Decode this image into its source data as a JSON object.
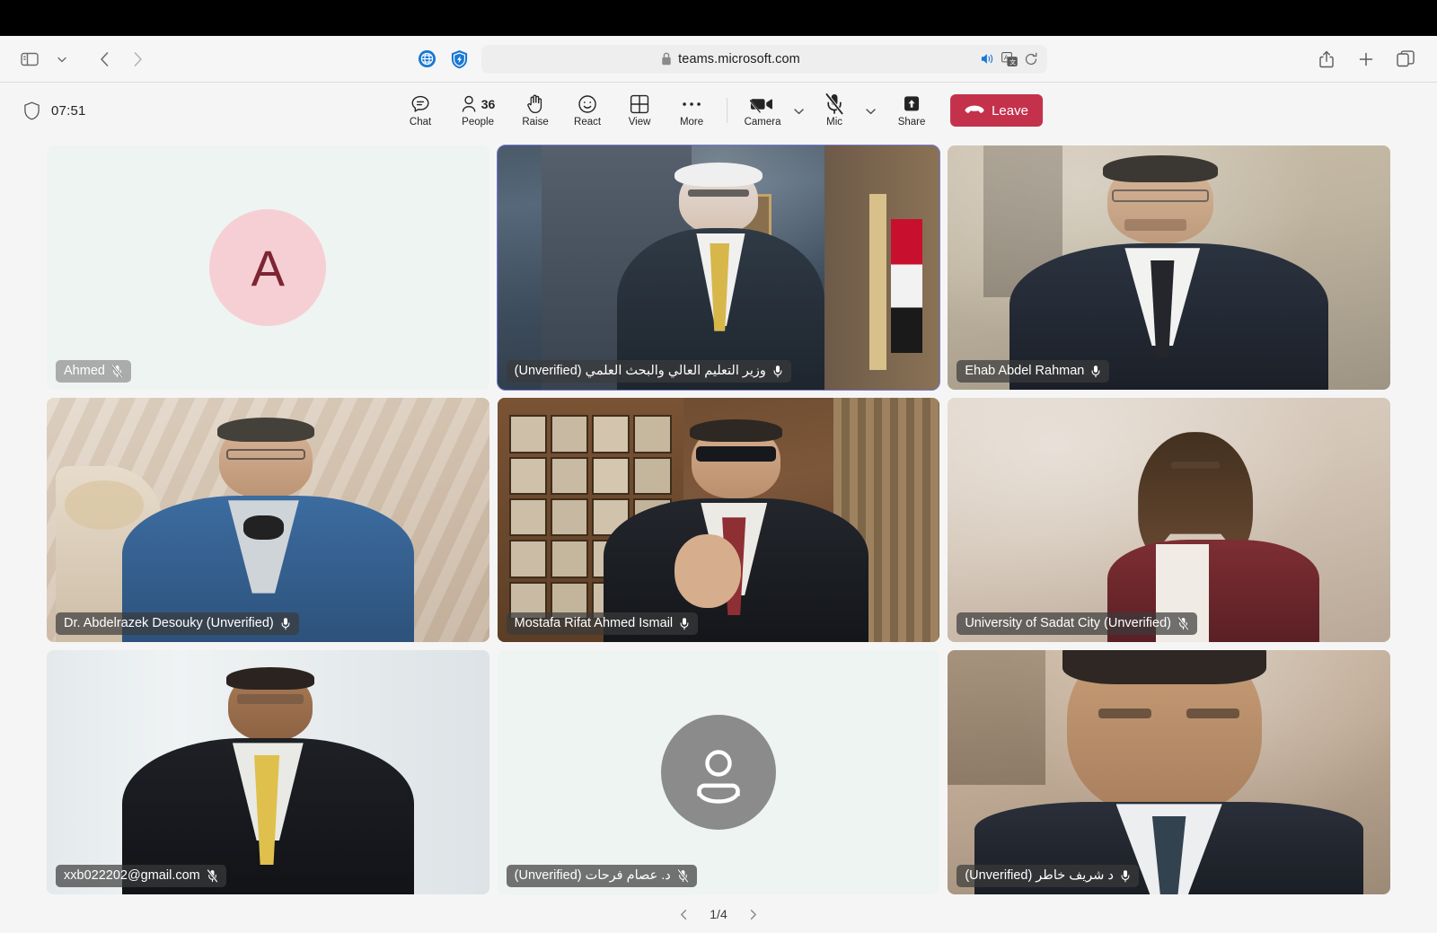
{
  "browser": {
    "url": "teams.microsoft.com",
    "lock_icon": "lock-icon",
    "nav": {
      "sidebar_icon": "sidebar-toggle-icon",
      "sidebar_chevron_icon": "chevron-down-icon",
      "back_icon": "back-arrow-icon",
      "forward_icon": "forward-arrow-icon"
    },
    "extensions": {
      "globe_icon": "globe-icon",
      "shield_icon": "shield-extension-icon"
    },
    "urlbar_right": {
      "speaker_icon": "speaker-playing-icon",
      "translate_icon": "translate-icon",
      "reload_icon": "reload-icon"
    },
    "right_buttons": {
      "share_icon": "share-icon",
      "new_tab_icon": "plus-new-tab-icon",
      "tab_overview_icon": "tab-overview-icon"
    }
  },
  "teams": {
    "status": {
      "shield_icon": "shield-icon",
      "elapsed_time": "07:51"
    },
    "toolbar": [
      {
        "id": "chat",
        "label": "Chat",
        "icon": "chat-bubble-icon",
        "badge": null
      },
      {
        "id": "people",
        "label": "People",
        "icon": "people-icon",
        "badge": "36"
      },
      {
        "id": "raise",
        "label": "Raise",
        "icon": "raised-hand-icon",
        "badge": null
      },
      {
        "id": "react",
        "label": "React",
        "icon": "smiley-face-icon",
        "badge": null
      },
      {
        "id": "view",
        "label": "View",
        "icon": "grid-view-icon",
        "badge": null
      },
      {
        "id": "more",
        "label": "More",
        "icon": "ellipsis-icon",
        "badge": null
      }
    ],
    "devices": [
      {
        "id": "camera",
        "label": "Camera",
        "icon": "camera-off-icon",
        "state": "off",
        "has_chevron": true
      },
      {
        "id": "mic",
        "label": "Mic",
        "icon": "mic-off-icon",
        "state": "off",
        "has_chevron": true
      },
      {
        "id": "share",
        "label": "Share",
        "icon": "share-screen-icon",
        "state": "idle",
        "has_chevron": false
      }
    ],
    "leave": {
      "label": "Leave",
      "icon": "hangup-phone-icon",
      "color": "#c4314b"
    },
    "pagination": {
      "page_label": "1/4",
      "prev_icon": "chevron-left-icon",
      "next_icon": "chevron-right-icon"
    },
    "participants": [
      {
        "id": "ahmed",
        "name": "Ahmed",
        "muted": true,
        "active_speaker": false,
        "tile_type": "avatar-letter",
        "avatar_letter": "A",
        "avatar_bg": "#f6cfd4",
        "avatar_fg": "#7d2533",
        "label_style": "light"
      },
      {
        "id": "minister",
        "name": "وزير التعليم العالي والبحث العلمي (Unverified)",
        "muted": false,
        "active_speaker": true,
        "tile_type": "video",
        "label_style": "dark"
      },
      {
        "id": "ehab",
        "name": "Ehab Abdel Rahman",
        "muted": false,
        "active_speaker": false,
        "tile_type": "video",
        "label_style": "dark"
      },
      {
        "id": "abdelrazek",
        "name": "Dr. Abdelrazek Desouky (Unverified)",
        "muted": false,
        "active_speaker": false,
        "tile_type": "video",
        "label_style": "dark"
      },
      {
        "id": "mostafa",
        "name": "Mostafa Rifat Ahmed Ismail",
        "muted": false,
        "active_speaker": false,
        "tile_type": "video",
        "label_style": "dark"
      },
      {
        "id": "sadat",
        "name": "University of Sadat City (Unverified)",
        "muted": true,
        "active_speaker": false,
        "tile_type": "video",
        "label_style": "dark"
      },
      {
        "id": "xxb",
        "name": "xxb022202@gmail.com",
        "muted": true,
        "active_speaker": false,
        "tile_type": "video",
        "label_style": "dark"
      },
      {
        "id": "essam",
        "name": "د. عصام فرحات (Unverified)",
        "muted": true,
        "active_speaker": false,
        "tile_type": "avatar-generic",
        "avatar_bg": "#8b8b8b",
        "label_style": "dark"
      },
      {
        "id": "sherif",
        "name": "د شريف خاطر (Unverified)",
        "muted": false,
        "active_speaker": false,
        "tile_type": "video",
        "label_style": "dark"
      }
    ]
  }
}
